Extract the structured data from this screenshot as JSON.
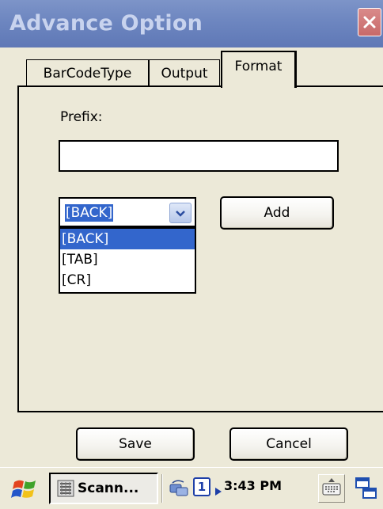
{
  "window": {
    "title": "Advance Option",
    "close_glyph": "×"
  },
  "tabs": [
    {
      "label": "BarCodeType",
      "active": false
    },
    {
      "label": "Output",
      "active": false
    },
    {
      "label": "Format",
      "active": true
    }
  ],
  "format": {
    "prefix_label": "Prefix:",
    "prefix_value": "",
    "combo_selected": "[BACK]",
    "combo_options": [
      "[BACK]",
      "[TAB]",
      "[CR]"
    ],
    "add_button": "Add"
  },
  "footer": {
    "save_button": "Save",
    "cancel_button": "Cancel"
  },
  "taskbar": {
    "task_label": "Scann...",
    "badge": "1",
    "clock": "3:43 PM",
    "icons": [
      "start-flag-icon",
      "scanner-app-icon",
      "connection-icon",
      "keyboard-icon",
      "window-switch-icon"
    ]
  },
  "colors": {
    "title_bar": "#6d86c0",
    "title_text": "#c8d3ee",
    "close_button": "#d07575",
    "selection": "#3366cc",
    "background": "#ece9d8"
  }
}
